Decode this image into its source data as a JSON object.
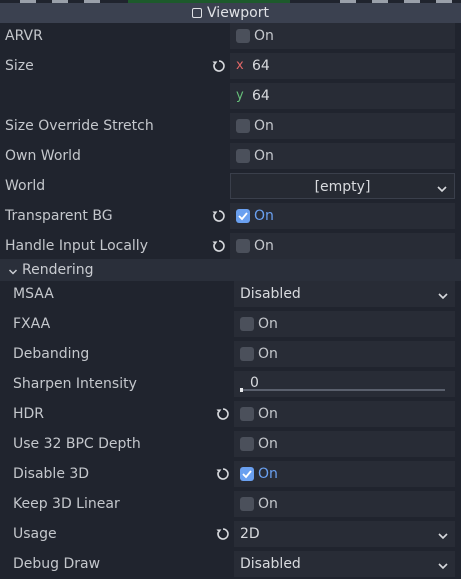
{
  "header": {
    "title": "Viewport"
  },
  "props": {
    "arvr": {
      "label": "ARVR",
      "value": "On"
    },
    "size": {
      "label": "Size",
      "x_axis": "x",
      "x": "64",
      "y_axis": "y",
      "y": "64"
    },
    "size_override_stretch": {
      "label": "Size Override Stretch",
      "value": "On"
    },
    "own_world": {
      "label": "Own World",
      "value": "On"
    },
    "world": {
      "label": "World",
      "value": "[empty]"
    },
    "transparent_bg": {
      "label": "Transparent BG",
      "value": "On"
    },
    "handle_input_locally": {
      "label": "Handle Input Locally",
      "value": "On"
    }
  },
  "rendering": {
    "section_label": "Rendering",
    "msaa": {
      "label": "MSAA",
      "value": "Disabled"
    },
    "fxaa": {
      "label": "FXAA",
      "value": "On"
    },
    "debanding": {
      "label": "Debanding",
      "value": "On"
    },
    "sharpen_intensity": {
      "label": "Sharpen Intensity",
      "value": "0"
    },
    "hdr": {
      "label": "HDR",
      "value": "On"
    },
    "use_32_bpc_depth": {
      "label": "Use 32 BPC Depth",
      "value": "On"
    },
    "disable_3d": {
      "label": "Disable 3D",
      "value": "On"
    },
    "keep_3d_linear": {
      "label": "Keep 3D Linear",
      "value": "On"
    },
    "usage": {
      "label": "Usage",
      "value": "2D"
    },
    "debug_draw": {
      "label": "Debug Draw",
      "value": "Disabled"
    }
  },
  "colors": {
    "accent": "#6aa0f0",
    "background": "#20242e",
    "field": "#282c36",
    "header": "#3b4150"
  },
  "icons": {
    "revert": "revert-icon",
    "checkbox_checked": "checkmark-icon",
    "dropdown": "chevron-down-icon",
    "section": "chevron-down-icon"
  }
}
